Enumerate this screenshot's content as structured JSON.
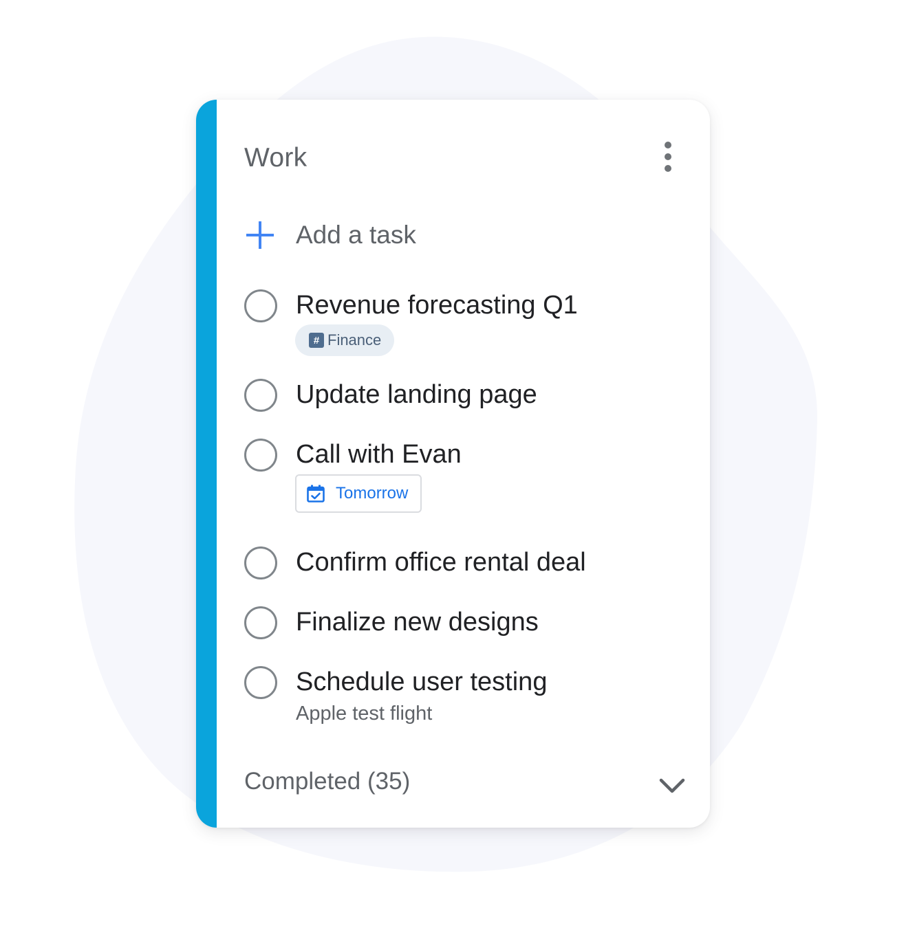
{
  "colors": {
    "accent": "#0aa4dc",
    "blob": "#f6f7fc",
    "plus_icon": "#4285f4",
    "date_chip": "#1a73e8"
  },
  "list": {
    "title": "Work",
    "menu_icon": "more-vert-icon"
  },
  "add_task": {
    "icon": "plus-icon",
    "label": "Add a task"
  },
  "tasks": [
    {
      "title": "Revenue forecasting Q1",
      "tag": {
        "icon": "hash-icon",
        "label": "Finance"
      }
    },
    {
      "title": "Update landing page"
    },
    {
      "title": "Call with Evan",
      "due": {
        "icon": "calendar-check-icon",
        "label": "Tomorrow"
      }
    },
    {
      "title": "Confirm office rental deal"
    },
    {
      "title": "Finalize new designs"
    },
    {
      "title": "Schedule user testing",
      "details": "Apple test flight"
    }
  ],
  "completed": {
    "label": "Completed (35)",
    "icon": "chevron-down-icon"
  }
}
